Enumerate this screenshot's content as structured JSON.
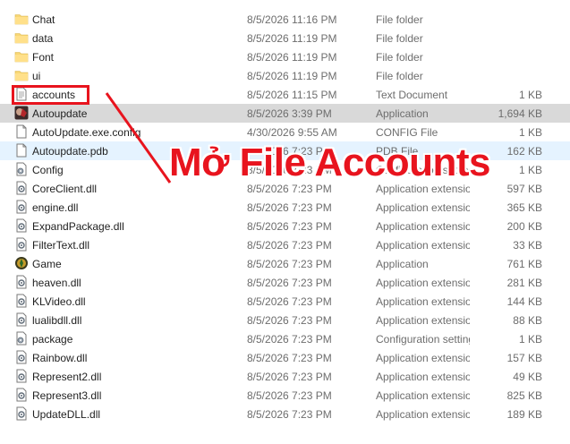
{
  "files": [
    {
      "name": "Chat",
      "date": "8/5/2026 11:16 PM",
      "type": "File folder",
      "size": "",
      "icon": "folder-icon"
    },
    {
      "name": "data",
      "date": "8/5/2026 11:19 PM",
      "type": "File folder",
      "size": "",
      "icon": "folder-icon"
    },
    {
      "name": "Font",
      "date": "8/5/2026 11:19 PM",
      "type": "File folder",
      "size": "",
      "icon": "folder-icon"
    },
    {
      "name": "ui",
      "date": "8/5/2026 11:19 PM",
      "type": "File folder",
      "size": "",
      "icon": "folder-icon"
    },
    {
      "name": "accounts",
      "date": "8/5/2026 11:15 PM",
      "type": "Text Document",
      "size": "1 KB",
      "icon": "text-document-icon"
    },
    {
      "name": "Autoupdate",
      "date": "8/5/2026 3:39 PM",
      "type": "Application",
      "size": "1,694 KB",
      "icon": "autoupdate-app-icon",
      "state": "selected"
    },
    {
      "name": "AutoUpdate.exe.config",
      "date": "4/30/2026 9:55 AM",
      "type": "CONFIG File",
      "size": "1 KB",
      "icon": "config-file-icon"
    },
    {
      "name": "Autoupdate.pdb",
      "date": "8/5/2026 7:23 PM",
      "type": "PDB File",
      "size": "162 KB",
      "icon": "pdb-file-icon",
      "state": "hover"
    },
    {
      "name": "Config",
      "date": "8/5/2026 7:23 PM",
      "type": "Configuration settings",
      "size": "1 KB",
      "icon": "settings-file-icon"
    },
    {
      "name": "CoreClient.dll",
      "date": "8/5/2026 7:23 PM",
      "type": "Application extension",
      "size": "597 KB",
      "icon": "dll-file-icon"
    },
    {
      "name": "engine.dll",
      "date": "8/5/2026 7:23 PM",
      "type": "Application extension",
      "size": "365 KB",
      "icon": "dll-file-icon"
    },
    {
      "name": "ExpandPackage.dll",
      "date": "8/5/2026 7:23 PM",
      "type": "Application extension",
      "size": "200 KB",
      "icon": "dll-file-icon"
    },
    {
      "name": "FilterText.dll",
      "date": "8/5/2026 7:23 PM",
      "type": "Application extension",
      "size": "33 KB",
      "icon": "dll-file-icon"
    },
    {
      "name": "Game",
      "date": "8/5/2026 7:23 PM",
      "type": "Application",
      "size": "761 KB",
      "icon": "game-app-icon"
    },
    {
      "name": "heaven.dll",
      "date": "8/5/2026 7:23 PM",
      "type": "Application extension",
      "size": "281 KB",
      "icon": "dll-file-icon"
    },
    {
      "name": "KLVideo.dll",
      "date": "8/5/2026 7:23 PM",
      "type": "Application extension",
      "size": "144 KB",
      "icon": "dll-file-icon"
    },
    {
      "name": "lualibdll.dll",
      "date": "8/5/2026 7:23 PM",
      "type": "Application extension",
      "size": "88 KB",
      "icon": "dll-file-icon"
    },
    {
      "name": "package",
      "date": "8/5/2026 7:23 PM",
      "type": "Configuration settings",
      "size": "1 KB",
      "icon": "settings-file-icon"
    },
    {
      "name": "Rainbow.dll",
      "date": "8/5/2026 7:23 PM",
      "type": "Application extension",
      "size": "157 KB",
      "icon": "dll-file-icon"
    },
    {
      "name": "Represent2.dll",
      "date": "8/5/2026 7:23 PM",
      "type": "Application extension",
      "size": "49 KB",
      "icon": "dll-file-icon"
    },
    {
      "name": "Represent3.dll",
      "date": "8/5/2026 7:23 PM",
      "type": "Application extension",
      "size": "825 KB",
      "icon": "dll-file-icon"
    },
    {
      "name": "UpdateDLL.dll",
      "date": "8/5/2026 7:23 PM",
      "type": "Application extension",
      "size": "189 KB",
      "icon": "dll-file-icon"
    }
  ],
  "annotation": {
    "text": "Mở File Accounts",
    "target": "accounts",
    "color": "#e8141e"
  },
  "colors": {
    "folder": "#f8d775",
    "selected_row": "#d9d9d9",
    "hover_row": "#e5f3ff",
    "secondary_text": "#6d6d6d"
  }
}
